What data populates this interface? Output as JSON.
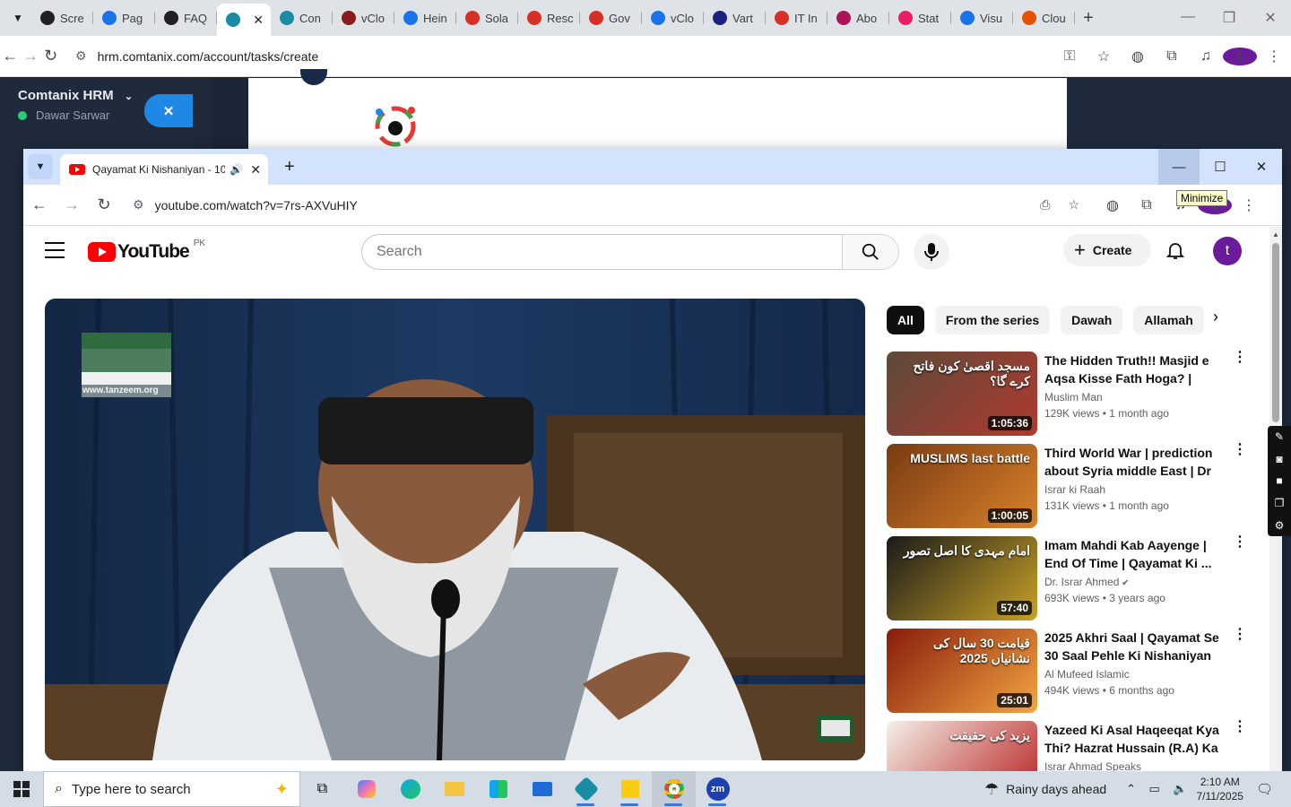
{
  "back_browser": {
    "tabs": [
      {
        "label": "Scre",
        "color": "#202124"
      },
      {
        "label": "Pag",
        "color": "#1a73e8"
      },
      {
        "label": "FAQ",
        "color": "#202124"
      },
      {
        "label": "",
        "color": "#1a8da5"
      },
      {
        "label": "Con",
        "color": "#1a8da5"
      },
      {
        "label": "vClo",
        "color": "#8b1a1a"
      },
      {
        "label": "Hein",
        "color": "#1a73e8"
      },
      {
        "label": "Sola",
        "color": "#d93025"
      },
      {
        "label": "Resc",
        "color": "#d93025"
      },
      {
        "label": "Gov",
        "color": "#d93025"
      },
      {
        "label": "vClo",
        "color": "#1a73e8"
      },
      {
        "label": "Vart",
        "color": "#1a237e"
      },
      {
        "label": "IT In",
        "color": "#d93025"
      },
      {
        "label": "Abo",
        "color": "#ad1457"
      },
      {
        "label": "Stat",
        "color": "#e91e63"
      },
      {
        "label": "Visu",
        "color": "#1a73e8"
      },
      {
        "label": "Clou",
        "color": "#e65100"
      }
    ],
    "url": "hrm.comtanix.com/account/tasks/create",
    "hrm": {
      "brand": "Comtanix HRM",
      "user": "Dawar Sarwar"
    }
  },
  "yt_browser": {
    "tab_title": "Qayamat Ki Nishaniyan - 10",
    "url": "youtube.com/watch?v=7rs-AXVuHIY",
    "tooltip": "Minimize",
    "profile_letter": "t"
  },
  "youtube": {
    "logo_word": "YouTube",
    "country": "PK",
    "search_placeholder": "Search",
    "create_label": "Create",
    "avatar_letter": "t",
    "player_watermark": "www.tanzeem.org",
    "chips": [
      "All",
      "From the series",
      "Dawah",
      "Allamah"
    ],
    "recommendations": [
      {
        "title": "The Hidden Truth!! Masjid e Aqsa Kisse Fath Hoga? | What ...",
        "channel": "Muslim Man",
        "stats": "129K views • 1 month ago",
        "duration": "1:05:36",
        "thumb_colors": [
          "#5c4a3a",
          "#b03a2e"
        ],
        "thumb_text": "مسجد اقصیٰ کون فاتح کرے گا؟"
      },
      {
        "title": "Third World War | prediction about Syria middle East | Dr ...",
        "channel": "Israr ki Raah",
        "stats": "131K views • 1 month ago",
        "duration": "1:00:05",
        "thumb_colors": [
          "#7a3b12",
          "#d9822b"
        ],
        "thumb_text": "MUSLIMS last battle"
      },
      {
        "title": "Imam Mahdi Kab Aayenge | End Of Time | Qayamat Ki ...",
        "channel": "Dr. Israr Ahmed",
        "stats": "693K views • 3 years ago",
        "duration": "57:40",
        "thumb_colors": [
          "#1a1a1a",
          "#c9a227"
        ],
        "thumb_text": "امام مہدی کا اصل تصور",
        "verified": true
      },
      {
        "title": "2025 Akhri Saal | Qayamat Se 30 Saal Pehle Ki Nishaniyan ...",
        "channel": "Al Mufeed Islamic",
        "stats": "494K views • 6 months ago",
        "duration": "25:01",
        "thumb_colors": [
          "#8a1c0c",
          "#f2a541"
        ],
        "thumb_text": "قیامت 30 سال کی نشانیاں 2025"
      },
      {
        "title": "Yazeed Ki Asal Haqeeqat Kya Thi? Hazrat Hussain (R.A) Ka ...",
        "channel": "Israr Ahmad Speaks",
        "stats": "",
        "duration": "",
        "thumb_colors": [
          "#f5f0e8",
          "#b71c1c"
        ],
        "thumb_text": "یزید کی حقیقت"
      }
    ]
  },
  "taskbar": {
    "search_placeholder": "Type here to search",
    "weather": "Rainy days ahead",
    "time": "2:10 AM",
    "date": "7/11/2025"
  }
}
